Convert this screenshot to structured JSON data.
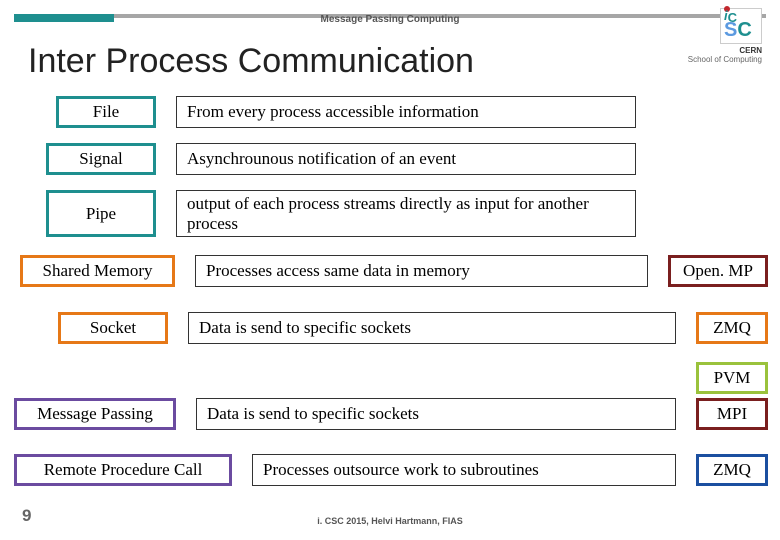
{
  "header": "Message Passing Computing",
  "title": "Inter Process Communication",
  "logo": {
    "line1": "CERN",
    "line2": "School of Computing"
  },
  "rows": [
    {
      "label": "File",
      "desc": "From every process accessible information"
    },
    {
      "label": "Signal",
      "desc": "Asynchrounous notification of an event"
    },
    {
      "label": "Pipe",
      "desc": "output of each process streams directly as input for another process"
    },
    {
      "label": "Shared Memory",
      "desc": "Processes access same data in memory",
      "tag": "Open. MP"
    },
    {
      "label": "Socket",
      "desc": "Data is send to specific sockets",
      "tag": "ZMQ"
    },
    {
      "tag_above": "PVM",
      "label": "Message Passing",
      "desc": "Data is send to specific sockets",
      "tag": "MPI"
    },
    {
      "label": "Remote Procedure Call",
      "desc": "Processes outsource work to subroutines",
      "tag": "ZMQ"
    }
  ],
  "page_number": "9",
  "footer": "i. CSC 2015, Helvi Hartmann, FIAS"
}
